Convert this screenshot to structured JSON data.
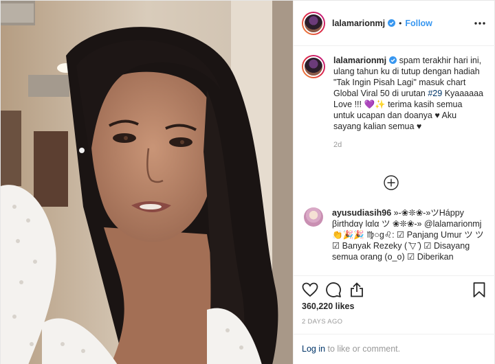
{
  "post": {
    "username": "lalamarionmj",
    "follow_separator": "•",
    "follow_label": "Follow",
    "caption_username": "lalamarionmj",
    "caption_text_1": " spam terakhir hari ini, ulang tahun ku di tutup dengan hadiah \"Tak Ingin Pisah Lagi\" masuk chart Global Viral 50 di urutan ",
    "caption_hashtag": "#29",
    "caption_text_2": " Kyaaaaaa Love !!! 💜✨ terima kasih semua untuk ucapan dan doanya ♥ Aku sayang kalian semua ♥",
    "caption_age": "2d",
    "likes": "360,220 likes",
    "date": "2 DAYS AGO"
  },
  "comment": {
    "username": "ayusudiasih96",
    "text": " »-❀❊❀-»ツHáppy βirthdαγ lαlα ツ ❀❊❀-» @lalamarionmj 👏🎉🎉 ♍○g♌: ☑ Panjang Umur ツ ツ ☑ Banyak Rezeky ( ̄▽ ̄) ☑ Disayang semua orang (o_o) ☑ Diberikan"
  },
  "login": {
    "login_link": "Log in",
    "suffix": " to like or comment."
  },
  "icons": {
    "verified": "verified-badge-icon",
    "more": "more-options-icon",
    "load_more": "load-more-comments-icon",
    "like": "heart-icon",
    "comment": "comment-bubble-icon",
    "share": "share-icon",
    "save": "bookmark-icon"
  },
  "colors": {
    "link_blue": "#3897f0",
    "hashtag": "#003569",
    "muted": "#999999"
  }
}
